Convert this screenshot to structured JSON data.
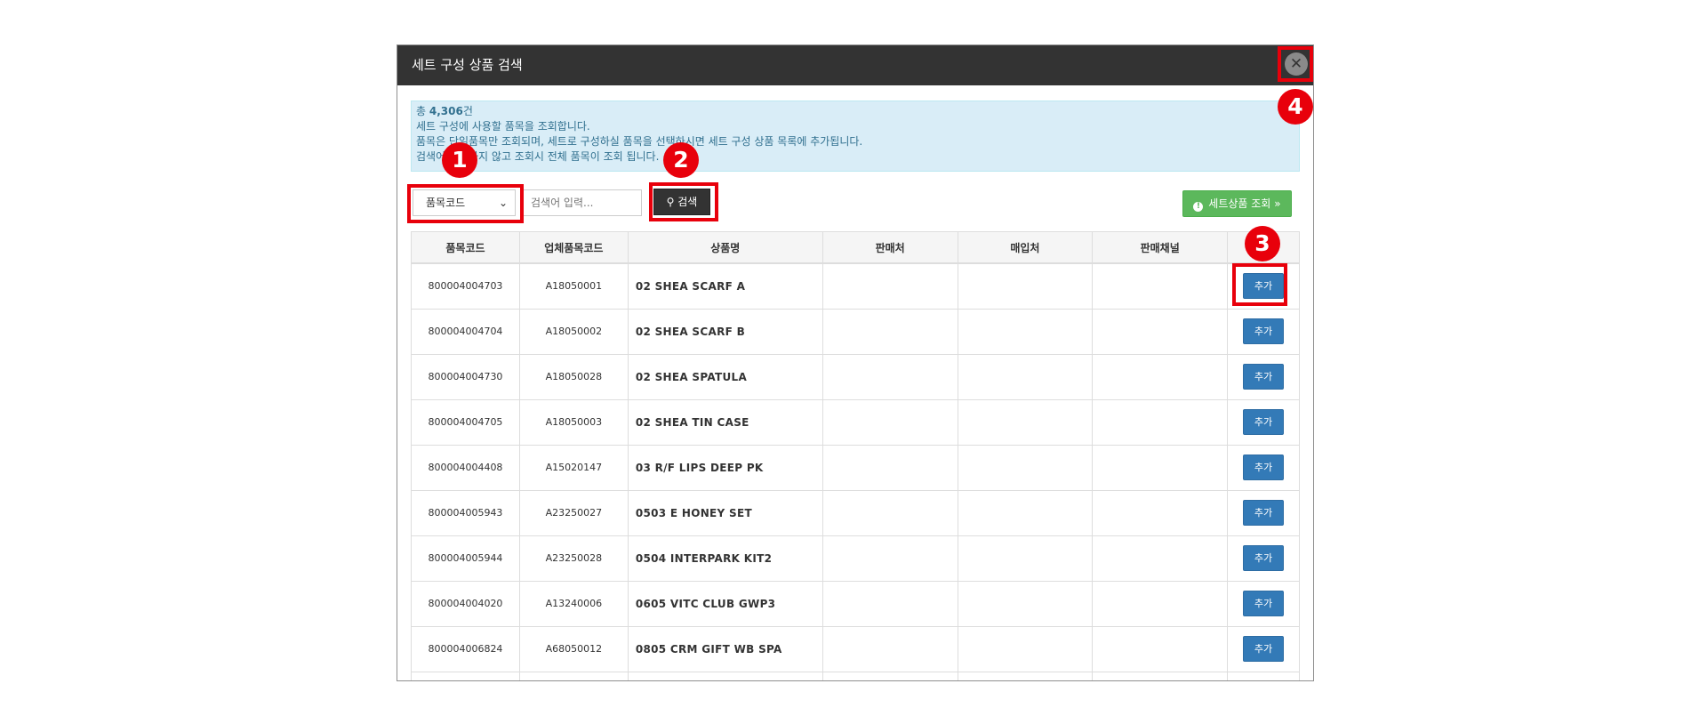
{
  "modal": {
    "title": "세트 구성 상품 검색",
    "close_glyph": "✕"
  },
  "info": {
    "total_prefix": "총 ",
    "total_count": "4,306",
    "total_suffix": "건",
    "line1": "세트 구성에 사용할 품목을 조회합니다.",
    "line2": "품목은 단일품목만 조회되며, 세트로 구성하실 품목을 선택하시면 세트 구성 상품 목록에 추가됩니다.",
    "line3": "검색어 입력하지 않고 조회시 전체 품목이 조회 됩니다."
  },
  "search": {
    "select_value": "품목코드",
    "placeholder": "검색어 입력...",
    "button_label": "검색"
  },
  "set_button": {
    "label": "세트상품 조회",
    "suffix": "»"
  },
  "table": {
    "headers": [
      "품목코드",
      "업체품목코드",
      "상품명",
      "판매처",
      "매입처",
      "판매채널",
      ""
    ],
    "add_label": "추가",
    "rows": [
      {
        "code": "800004004703",
        "vendor_code": "A18050001",
        "name": "02 SHEA SCARF A"
      },
      {
        "code": "800004004704",
        "vendor_code": "A18050002",
        "name": "02 SHEA SCARF B"
      },
      {
        "code": "800004004730",
        "vendor_code": "A18050028",
        "name": "02 SHEA SPATULA"
      },
      {
        "code": "800004004705",
        "vendor_code": "A18050003",
        "name": "02 SHEA TIN CASE"
      },
      {
        "code": "800004004408",
        "vendor_code": "A15020147",
        "name": "03 R/F LIPS DEEP PK"
      },
      {
        "code": "800004005943",
        "vendor_code": "A23250027",
        "name": "0503 E HONEY SET"
      },
      {
        "code": "800004005944",
        "vendor_code": "A23250028",
        "name": "0504 INTERPARK KIT2"
      },
      {
        "code": "800004004020",
        "vendor_code": "A13240006",
        "name": "0605 VITC CLUB GWP3"
      },
      {
        "code": "800004006824",
        "vendor_code": "A68050012",
        "name": "0805 CRM GIFT WB SPA"
      },
      {
        "code": "",
        "vendor_code": "",
        "name": ""
      }
    ]
  },
  "markers": [
    "1",
    "2",
    "3",
    "4"
  ],
  "colors": {
    "header": "#333333",
    "info_bg": "#d9edf7",
    "info_text": "#31708f",
    "primary": "#337ab7",
    "success": "#5cb85c",
    "highlight": "#e8000b"
  }
}
